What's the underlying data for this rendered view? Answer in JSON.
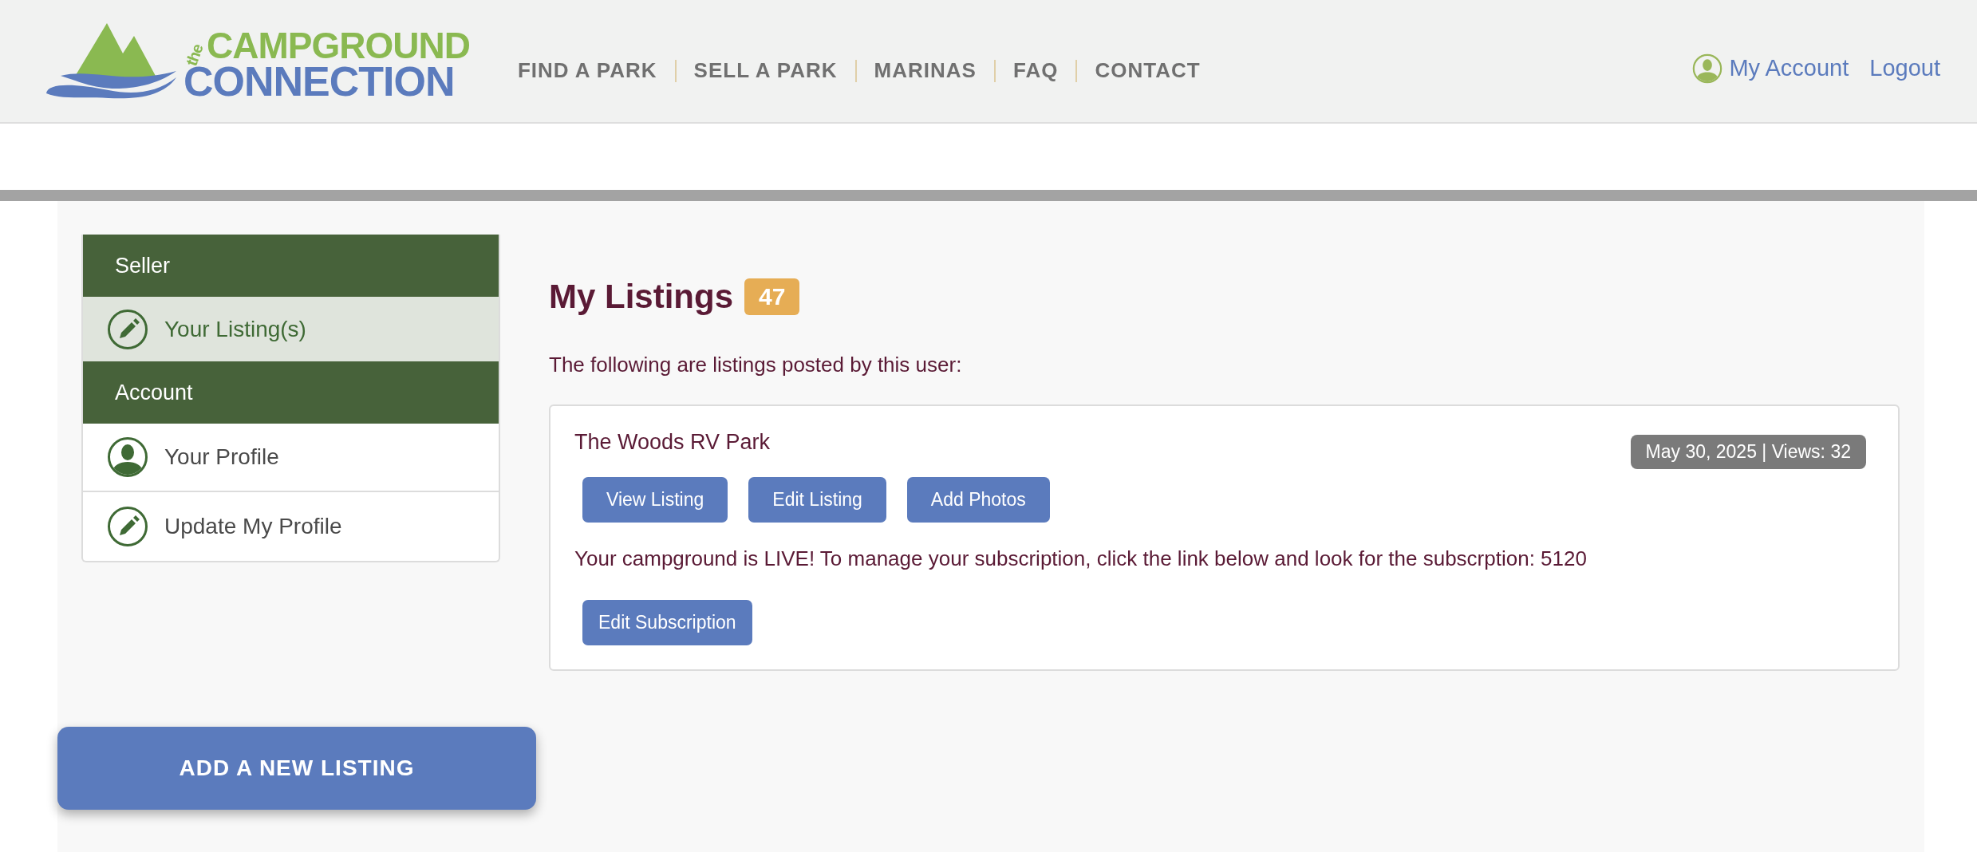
{
  "header": {
    "logo": {
      "prefix": "the",
      "line1": "CAMPGROUND",
      "line2": "CONNECTION"
    },
    "nav": [
      "FIND A PARK",
      "SELL A PARK",
      "MARINAS",
      "FAQ",
      "CONTACT"
    ],
    "account_links": [
      {
        "label": "My Account",
        "kind": "account"
      },
      {
        "label": "Logout",
        "kind": "plain"
      }
    ]
  },
  "sidebar": {
    "sections": [
      {
        "title": "Seller",
        "items": [
          {
            "label": "Your Listing(s)",
            "kind": "edit",
            "selected": true
          }
        ]
      },
      {
        "title": "Account",
        "items": [
          {
            "label": "Your Profile",
            "kind": "profile",
            "selected": false
          },
          {
            "label": "Update My Profile",
            "kind": "edit",
            "selected": false
          }
        ]
      }
    ],
    "add_button": "ADD A NEW LISTING"
  },
  "main": {
    "title": "My Listings",
    "count": "47",
    "intro": "The following are listings posted by this user:",
    "listings": [
      {
        "name": "The Woods RV Park",
        "meta": "May 30, 2025 | Views: 32",
        "actions": [
          "View Listing",
          "Edit Listing",
          "Add Photos"
        ],
        "status": "Your campground is LIVE! To manage your subscription, click the link below and look for the subscrption: 5120",
        "subscription_button": "Edit Subscription"
      }
    ]
  }
}
